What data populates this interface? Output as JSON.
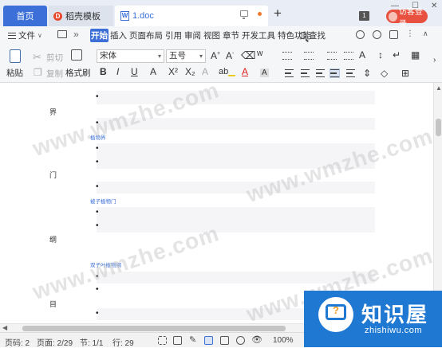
{
  "titlebar": {
    "tabs": [
      {
        "label": "首页"
      },
      {
        "label": "稻壳模板",
        "logo": "D"
      },
      {
        "label": "1.doc",
        "logo": "W"
      }
    ],
    "badge": "1",
    "visitor_login": "访客登录"
  },
  "menubar": {
    "file_label": "文件",
    "tabs": [
      "开始",
      "插入",
      "页面布局",
      "引用",
      "审阅",
      "视图",
      "章节",
      "开发工具",
      "特色功能"
    ],
    "active_tab": "开始",
    "search_label": "查找"
  },
  "ribbon": {
    "paste_label": "粘贴",
    "cut_label": "剪切",
    "copy_label": "复制",
    "format_painter_label": "格式刷",
    "font_name": "宋体",
    "font_size": "五号"
  },
  "document": {
    "left_chars": [
      "界",
      "门",
      "纲",
      "目"
    ],
    "blue_labels": [
      "植物界",
      "被子植物门",
      "双子叶植物纲"
    ],
    "bullet": "•",
    "watermark": "www.wmzhe.com"
  },
  "statusbar": {
    "page_code": "页码: 2",
    "page": "页面: 2/29",
    "section": "节: 1/1",
    "row": "行: 29",
    "zoom": "100%"
  },
  "overlay_logo": {
    "title": "知识屋",
    "subtitle": "zhishiwu.com"
  }
}
